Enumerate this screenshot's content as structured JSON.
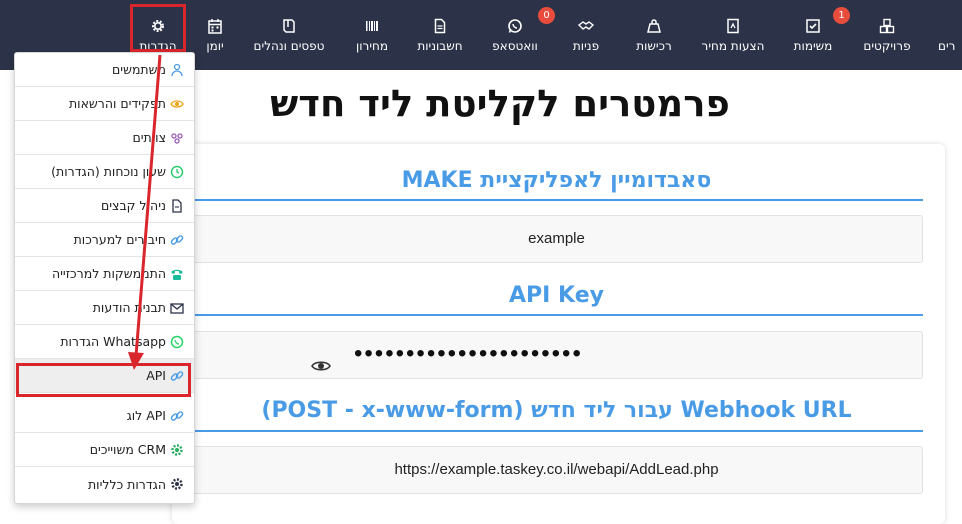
{
  "nav": {
    "items": [
      {
        "key": "settings",
        "label": "הגדרות",
        "icon": "gear-icon"
      },
      {
        "key": "calendar",
        "label": "יומן",
        "icon": "calendar-icon"
      },
      {
        "key": "forms",
        "label": "טפסים ונהלים",
        "icon": "book-icon"
      },
      {
        "key": "pricelist",
        "label": "מחירון",
        "icon": "barcode-icon"
      },
      {
        "key": "invoices",
        "label": "חשבוניות",
        "icon": "document-icon"
      },
      {
        "key": "whatsapp",
        "label": "וואטסאפ",
        "icon": "whatsapp-icon",
        "badge": "0"
      },
      {
        "key": "leads",
        "label": "פניות",
        "icon": "handshake-icon"
      },
      {
        "key": "purchases",
        "label": "רכישות",
        "icon": "tag-icon"
      },
      {
        "key": "quotes",
        "label": "הצעות מחיר",
        "icon": "quote-icon"
      },
      {
        "key": "tasks",
        "label": "משימות",
        "icon": "checkbox-icon",
        "badge": "1"
      },
      {
        "key": "projects",
        "label": "פרויקטים",
        "icon": "cubes-icon"
      },
      {
        "key": "clients",
        "label": "רים",
        "icon": "users-icon"
      }
    ]
  },
  "page": {
    "title": "פרמטרים לקליטת ליד חדש",
    "subdomain_title": "סאבדומיין לאפליקציית MAKE",
    "subdomain_value": "example",
    "apikey_title": "API Key",
    "apikey_value": "••••••••••••••••••••••",
    "webhook_title": "Webhook URL עבור ליד חדש (POST - x-www-form)",
    "webhook_value": "https://example.taskey.co.il/webapi/AddLead.php"
  },
  "dropdown": {
    "items": [
      {
        "label": "משתמשים",
        "icon": "users-icon"
      },
      {
        "label": "תפקידים והרשאות",
        "icon": "eye-icon"
      },
      {
        "label": "צוותים",
        "icon": "team-icon"
      },
      {
        "label": "שעון נוכחות (הגדרות)",
        "icon": "clock-icon"
      },
      {
        "label": "ניהול קבצים",
        "icon": "file-icon"
      },
      {
        "label": "חיבורים למערכות",
        "icon": "link-icon"
      },
      {
        "label": "התממשקות למרכזייה",
        "icon": "phone-icon"
      },
      {
        "label": "תבנית הודעות",
        "icon": "envelope-icon"
      },
      {
        "label": "Whatsapp הגדרות",
        "icon": "whatsapp-icon"
      },
      {
        "label": "API",
        "icon": "link-icon"
      },
      {
        "label": "API לוג",
        "icon": "link-icon"
      },
      {
        "label": "CRM משוייכים",
        "icon": "gear-icon"
      },
      {
        "label": "הגדרות כלליות",
        "icon": "gear-icon"
      }
    ]
  },
  "colors": {
    "nav_bg": "#2c3247",
    "accent": "#4a9be6",
    "highlight": "#d9262d",
    "badge": "#e74c3c"
  }
}
